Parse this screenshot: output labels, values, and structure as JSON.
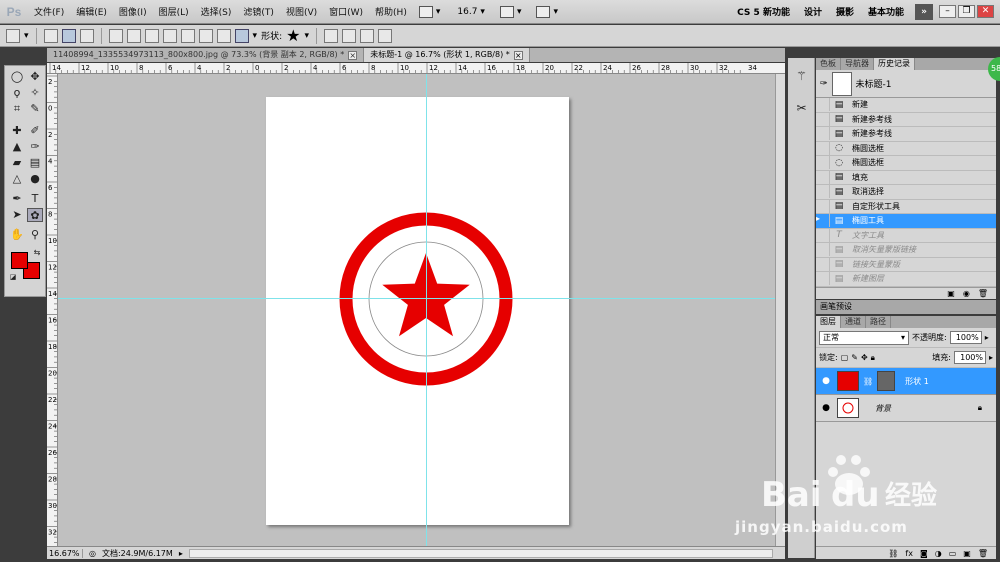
{
  "app": {
    "logo": "Ps"
  },
  "menu": {
    "items": [
      "文件(F)",
      "编辑(E)",
      "图像(I)",
      "图层(L)",
      "选择(S)",
      "滤镜(T)",
      "视图(V)",
      "窗口(W)",
      "帮助(H)"
    ]
  },
  "menubar_ctrls": {
    "zoom_value": "16.7"
  },
  "workspaces": [
    "CS 5 新功能",
    "设计",
    "摄影",
    "基本功能"
  ],
  "workspace_more": "»",
  "options": {
    "shape_label": "形状:"
  },
  "doc_tabs": [
    {
      "title": "11408994_1335534973113_800x800.jpg @ 73.3% (背景 副本 2, RGB/8) *",
      "active": false
    },
    {
      "title": "未标题-1 @ 16.7% (形状 1, RGB/8) *",
      "active": true
    }
  ],
  "ruler": {
    "top_marks": [
      "14",
      "12",
      "10",
      "8",
      "6",
      "4",
      "2",
      "0",
      "2",
      "4",
      "6",
      "8",
      "10",
      "12",
      "14",
      "16",
      "18",
      "20",
      "22",
      "24",
      "26",
      "28",
      "30",
      "32",
      "34"
    ],
    "left_marks": [
      "2",
      "0",
      "2",
      "4",
      "6",
      "8",
      "10",
      "12",
      "14",
      "16",
      "18",
      "20",
      "22",
      "24",
      "26",
      "28",
      "30",
      "32"
    ]
  },
  "canvas": {
    "accent_red": "#e60000",
    "guide_color": "#7fe3ea",
    "bg": "#c0c0c0"
  },
  "status": {
    "zoom": "16.67%",
    "doc_info": "文档:24.9M/6.17M"
  },
  "panels": {
    "history_tabs": [
      "色板",
      "导航器",
      "历史记录"
    ],
    "snapshot_label": "未标题-1",
    "history": [
      {
        "label": "新建",
        "icon": "doc",
        "state": "normal"
      },
      {
        "label": "新建参考线",
        "icon": "doc",
        "state": "normal"
      },
      {
        "label": "新建参考线",
        "icon": "doc",
        "state": "normal"
      },
      {
        "label": "椭圆选框",
        "icon": "marquee",
        "state": "normal"
      },
      {
        "label": "椭圆选框",
        "icon": "marquee",
        "state": "normal"
      },
      {
        "label": "填充",
        "icon": "doc",
        "state": "normal"
      },
      {
        "label": "取消选择",
        "icon": "doc",
        "state": "normal"
      },
      {
        "label": "自定形状工具",
        "icon": "doc",
        "state": "normal"
      },
      {
        "label": "椭圆工具",
        "icon": "doc",
        "state": "active"
      },
      {
        "label": "文字工具",
        "icon": "text",
        "state": "dim"
      },
      {
        "label": "取消矢量蒙版链接",
        "icon": "doc",
        "state": "dim"
      },
      {
        "label": "链接矢量蒙版",
        "icon": "doc",
        "state": "dim"
      },
      {
        "label": "新建图层",
        "icon": "doc",
        "state": "dim"
      }
    ],
    "brush_preset_label": "画笔预设",
    "layers_tabs": [
      "图层",
      "通道",
      "路径"
    ],
    "blend_mode": "正常",
    "opacity_label": "不透明度:",
    "opacity": "100%",
    "lock_label": "锁定:",
    "fill_label": "填充:",
    "fill": "100%",
    "layers": [
      {
        "name": "形状 1",
        "thumb_color": "#e60000",
        "active": true
      },
      {
        "name": "背景",
        "thumb_color": "#ffffff",
        "active": false
      }
    ]
  },
  "watermark": {
    "line": "jingyan.baidu.com"
  }
}
